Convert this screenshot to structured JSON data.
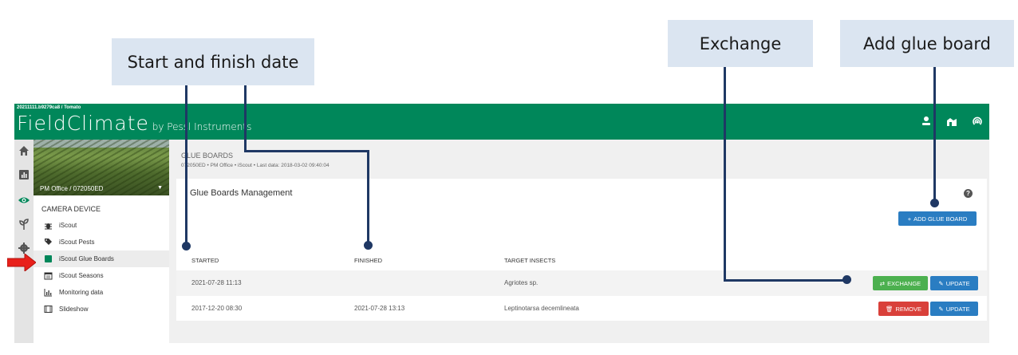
{
  "callouts": {
    "start_finish": "Start and finish date",
    "exchange": "Exchange",
    "add_glue_board": "Add glue board"
  },
  "header": {
    "device_id": "20211111.b9279ca8 / Tomato",
    "logo": "FieldClimate",
    "logo_by": " by Pessl Instruments",
    "icons": [
      "user-icon",
      "station-map-icon",
      "wireless-icon"
    ]
  },
  "rail": {
    "icons": [
      "home-icon",
      "chart-icon",
      "eye-icon",
      "leaf-icon",
      "settings-icon"
    ]
  },
  "sidebar": {
    "station": "PM Office / 072050ED",
    "section": "CAMERA DEVICE",
    "items": [
      {
        "label": "iScout",
        "icon": "bug-icon"
      },
      {
        "label": "iScout Pests",
        "icon": "tags-icon"
      },
      {
        "label": "iScout Glue Boards",
        "icon": "square-icon",
        "active": true
      },
      {
        "label": "iScout Seasons",
        "icon": "calendar-icon"
      },
      {
        "label": "Monitoring data",
        "icon": "bar-chart-icon"
      },
      {
        "label": "Slideshow",
        "icon": "film-icon"
      }
    ]
  },
  "page": {
    "title": "GLUE BOARDS",
    "subtitle": "072050ED • PM Office • iScout • Last data: 2018-03-02 09:40:04"
  },
  "card": {
    "title": "Glue Boards Management",
    "add_button": "ADD GLUE BOARD",
    "columns": [
      "STARTED",
      "FINISHED",
      "TARGET INSECTS"
    ],
    "rows": [
      {
        "started": "2021-07-28 11:13",
        "finished": "",
        "target": "Agriotes sp.",
        "action": "EXCHANGE",
        "update": "UPDATE"
      },
      {
        "started": "2017-12-20 08:30",
        "finished": "2021-07-28 13:13",
        "target": "Leptinotarsa decemlineata",
        "action": "REMOVE",
        "update": "UPDATE"
      }
    ]
  },
  "colors": {
    "topbar": "#00875a",
    "callout_bg": "#dbe5f1",
    "leader": "#1f3864",
    "btn_blue": "#2a7dc2",
    "btn_green": "#4cb04f",
    "btn_red": "#d9403a",
    "arrow": "#e8201a"
  }
}
